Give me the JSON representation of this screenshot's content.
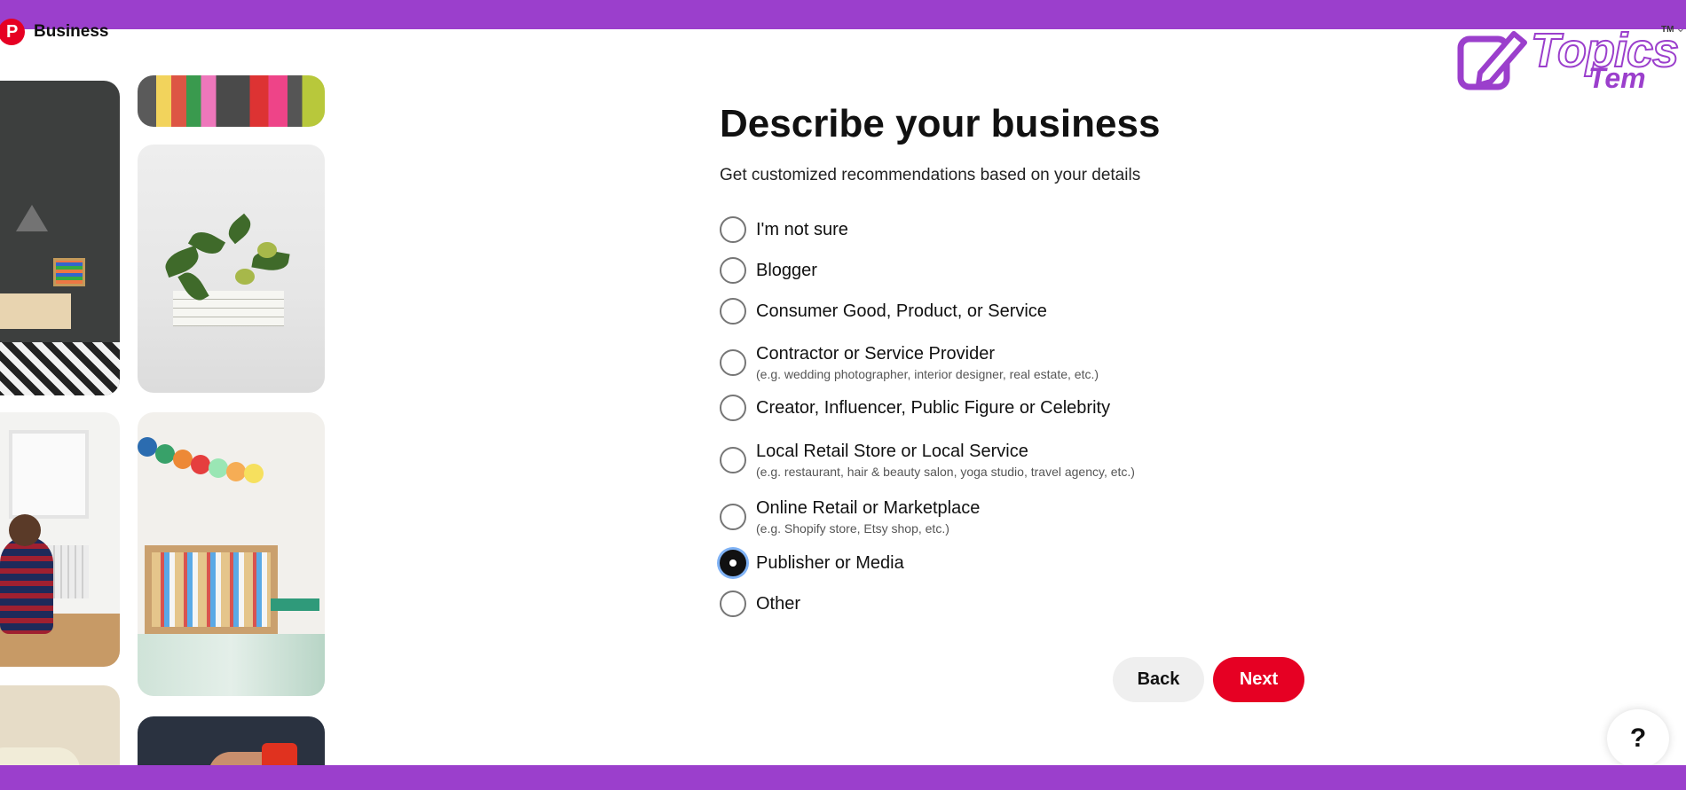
{
  "brand": {
    "label": "Business"
  },
  "watermark": {
    "word": "Topics",
    "sub": "Tem",
    "tm": "TM"
  },
  "form": {
    "title": "Describe your business",
    "subtitle": "Get customized recommendations based on your details",
    "options": [
      {
        "label": "I'm not sure",
        "sub": "",
        "selected": false
      },
      {
        "label": "Blogger",
        "sub": "",
        "selected": false
      },
      {
        "label": "Consumer Good, Product, or Service",
        "sub": "",
        "selected": false
      },
      {
        "label": "Contractor or Service Provider",
        "sub": "(e.g. wedding photographer, interior designer, real estate, etc.)",
        "selected": false
      },
      {
        "label": "Creator, Influencer, Public Figure or Celebrity",
        "sub": "",
        "selected": false
      },
      {
        "label": "Local Retail Store or Local Service",
        "sub": "(e.g. restaurant, hair & beauty salon, yoga studio, travel agency, etc.)",
        "selected": false
      },
      {
        "label": "Online Retail or Marketplace",
        "sub": "(e.g. Shopify store, Etsy shop, etc.)",
        "selected": false
      },
      {
        "label": "Publisher or Media",
        "sub": "",
        "selected": true
      },
      {
        "label": "Other",
        "sub": "",
        "selected": false
      }
    ],
    "back_label": "Back",
    "next_label": "Next"
  },
  "help": {
    "label": "?"
  },
  "colors": {
    "frame": "#9b3fcc",
    "accent": "#e60023",
    "selected": "#111111",
    "focus_ring": "#7fb2f5"
  },
  "icons": {
    "brand": "pinterest-logo-icon",
    "help": "help-icon",
    "watermark": "pencil-logo-icon"
  }
}
